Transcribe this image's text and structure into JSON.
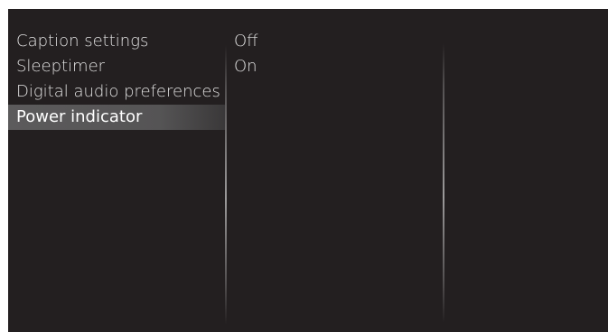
{
  "menu": {
    "items": [
      {
        "label": "Caption settings"
      },
      {
        "label": "Sleeptimer"
      },
      {
        "label": "Digital audio preferences"
      },
      {
        "label": "Power indicator"
      }
    ]
  },
  "options": {
    "items": [
      {
        "label": "Off"
      },
      {
        "label": "On"
      }
    ]
  },
  "colors": {
    "background": "#231f20",
    "text": "#e0e0e0",
    "selected_bg": "#5c5b5c",
    "selected_text": "#ffffff"
  }
}
